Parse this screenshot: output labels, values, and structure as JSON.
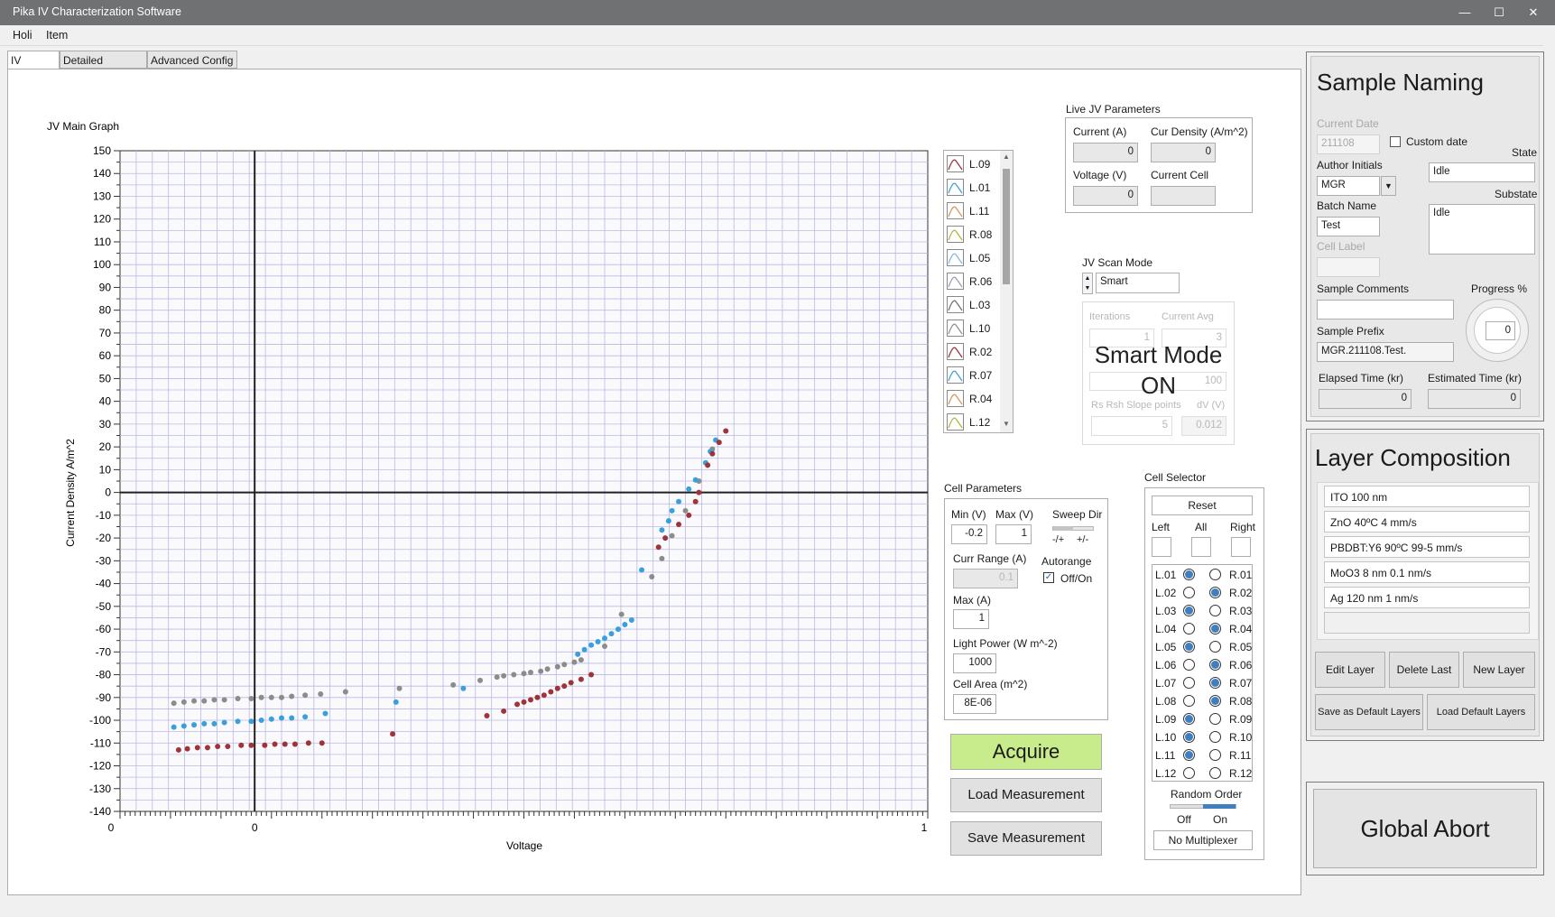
{
  "window": {
    "title": "Pika IV Characterization Software",
    "minimize": "—",
    "maximize": "☐",
    "close": "✕"
  },
  "menu": [
    "Holi",
    "Item"
  ],
  "tabs": [
    "IV Curves",
    "Detailed Analysis",
    "Advanced Config"
  ],
  "chart_data": {
    "type": "scatter",
    "title": "JV Main Graph",
    "xlabel": "Voltage",
    "ylabel": "Current Density A/m^2",
    "xlim": [
      -0.2,
      1
    ],
    "ylim": [
      -140,
      150
    ],
    "x_tick_labels": [
      "0",
      "0",
      "1"
    ],
    "y_ticks": [
      150,
      140,
      130,
      120,
      110,
      100,
      90,
      80,
      70,
      60,
      50,
      40,
      30,
      20,
      10,
      0,
      -10,
      -20,
      -30,
      -40,
      -50,
      -60,
      -70,
      -80,
      -90,
      -100,
      -110,
      -120,
      -130,
      -140
    ],
    "grid": true,
    "series": [
      {
        "color": "#8c8c8c",
        "points": [
          [
            -0.12,
            -92.5
          ],
          [
            -0.105,
            -92
          ],
          [
            -0.09,
            -91.5
          ],
          [
            -0.075,
            -91.5
          ],
          [
            -0.06,
            -91
          ],
          [
            -0.045,
            -91
          ],
          [
            -0.025,
            -90.5
          ],
          [
            -0.005,
            -90.5
          ],
          [
            0.01,
            -90
          ],
          [
            0.025,
            -90
          ],
          [
            0.04,
            -90
          ],
          [
            0.055,
            -89.5
          ],
          [
            0.075,
            -89
          ],
          [
            0.098,
            -88.5
          ],
          [
            0.135,
            -87.5
          ],
          [
            0.215,
            -86
          ],
          [
            0.295,
            -84.5
          ],
          [
            0.335,
            -82.5
          ],
          [
            0.36,
            -81
          ],
          [
            0.37,
            -80.5
          ],
          [
            0.385,
            -80
          ],
          [
            0.4,
            -79.5
          ],
          [
            0.41,
            -79
          ],
          [
            0.425,
            -78.5
          ],
          [
            0.435,
            -77.5
          ],
          [
            0.45,
            -76.5
          ],
          [
            0.46,
            -75.5
          ],
          [
            0.475,
            -74.5
          ],
          [
            0.485,
            -73.5
          ],
          [
            0.52,
            -67.5
          ],
          [
            0.545,
            -53.5
          ],
          [
            0.59,
            -37
          ],
          [
            0.605,
            -29
          ],
          [
            0.62,
            -19
          ],
          [
            0.64,
            -8
          ],
          [
            0.66,
            5
          ],
          [
            0.68,
            19
          ]
        ]
      },
      {
        "color": "#3aa0dd",
        "points": [
          [
            -0.12,
            -103
          ],
          [
            -0.105,
            -102.5
          ],
          [
            -0.09,
            -102
          ],
          [
            -0.075,
            -101.5
          ],
          [
            -0.06,
            -101.5
          ],
          [
            -0.045,
            -101
          ],
          [
            -0.025,
            -100.5
          ],
          [
            -0.005,
            -100.5
          ],
          [
            0.01,
            -100
          ],
          [
            0.025,
            -99.5
          ],
          [
            0.04,
            -99
          ],
          [
            0.055,
            -99
          ],
          [
            0.075,
            -98.5
          ],
          [
            0.105,
            -97
          ],
          [
            0.21,
            -92
          ],
          [
            0.31,
            -86
          ],
          [
            0.48,
            -71
          ],
          [
            0.49,
            -69
          ],
          [
            0.5,
            -67
          ],
          [
            0.51,
            -65.5
          ],
          [
            0.52,
            -64
          ],
          [
            0.53,
            -62
          ],
          [
            0.54,
            -60
          ],
          [
            0.55,
            -58
          ],
          [
            0.56,
            -56
          ],
          [
            0.575,
            -34
          ],
          [
            0.605,
            -16.5
          ],
          [
            0.615,
            -12.5
          ],
          [
            0.62,
            -8
          ],
          [
            0.63,
            -4
          ],
          [
            0.645,
            1.5
          ],
          [
            0.655,
            5.5
          ],
          [
            0.67,
            13
          ],
          [
            0.677,
            18
          ],
          [
            0.685,
            23
          ]
        ]
      },
      {
        "color": "#a0323a",
        "points": [
          [
            -0.113,
            -113
          ],
          [
            -0.1,
            -112.5
          ],
          [
            -0.085,
            -112
          ],
          [
            -0.07,
            -112
          ],
          [
            -0.055,
            -111.5
          ],
          [
            -0.04,
            -111.5
          ],
          [
            -0.02,
            -111
          ],
          [
            -0.005,
            -111
          ],
          [
            0.015,
            -111
          ],
          [
            0.03,
            -110.5
          ],
          [
            0.045,
            -110.5
          ],
          [
            0.06,
            -110.5
          ],
          [
            0.08,
            -110
          ],
          [
            0.1,
            -110
          ],
          [
            0.205,
            -106
          ],
          [
            0.345,
            -98
          ],
          [
            0.37,
            -96
          ],
          [
            0.39,
            -93
          ],
          [
            0.4,
            -92
          ],
          [
            0.41,
            -91
          ],
          [
            0.42,
            -90
          ],
          [
            0.43,
            -89
          ],
          [
            0.44,
            -87.5
          ],
          [
            0.45,
            -86
          ],
          [
            0.46,
            -85
          ],
          [
            0.47,
            -83.5
          ],
          [
            0.485,
            -82
          ],
          [
            0.5,
            -80
          ],
          [
            0.6,
            -24
          ],
          [
            0.61,
            -20
          ],
          [
            0.63,
            -14
          ],
          [
            0.645,
            -10
          ],
          [
            0.655,
            -4
          ],
          [
            0.66,
            0
          ],
          [
            0.673,
            12
          ],
          [
            0.68,
            17
          ],
          [
            0.69,
            22
          ],
          [
            0.7,
            27
          ]
        ]
      }
    ]
  },
  "legend": [
    {
      "label": "L.09",
      "color": "#a0323a"
    },
    {
      "label": "L.01",
      "color": "#3aa0dd"
    },
    {
      "label": "L.11",
      "color": "#d8955a"
    },
    {
      "label": "R.08",
      "color": "#b5b53a"
    },
    {
      "label": "L.05",
      "color": "#7fb8e8"
    },
    {
      "label": "R.06",
      "color": "#9aa0b8"
    },
    {
      "label": "L.03",
      "color": "#707070"
    },
    {
      "label": "L.10",
      "color": "#909090"
    },
    {
      "label": "R.02",
      "color": "#a0323a"
    },
    {
      "label": "R.07",
      "color": "#3aa0dd"
    },
    {
      "label": "R.04",
      "color": "#d8955a"
    },
    {
      "label": "L.12",
      "color": "#b5b53a"
    }
  ],
  "live": {
    "title": "Live JV Parameters",
    "current_label": "Current (A)",
    "current": "0",
    "curdens_label": "Cur Density (A/m^2)",
    "curdens": "0",
    "voltage_label": "Voltage (V)",
    "voltage": "0",
    "cell_label": "Current Cell",
    "cell": ""
  },
  "scan": {
    "title": "JV Scan Mode",
    "mode": "Smart",
    "iter_label": "Iterations",
    "iter": "1",
    "avg_label": "Current Avg",
    "avg": "3",
    "sweep_val": "100",
    "rs_label": "Rs Rsh Slope points",
    "rs": "5",
    "dv_label": "dV (V)",
    "dv": "0.012",
    "smart_overlay": "Smart Mode ON"
  },
  "cellparams": {
    "title": "Cell Parameters",
    "min_label": "Min (V)",
    "min": "-0.2",
    "max_label": "Max (V)",
    "max": "1",
    "sweep_label": "Sweep Dir",
    "sweep_minus": "-/+",
    "sweep_plus": "+/-",
    "curr_range_label": "Curr Range (A)",
    "curr_range": "0.1",
    "autorange_label": "Autorange",
    "autorange_toggle": "Off/On",
    "maxa_label": "Max (A)",
    "maxa": "1",
    "light_label": "Light Power (W m^-2)",
    "light": "1000",
    "area_label": "Cell Area (m^2)",
    "area": "8E-06"
  },
  "actions": {
    "acquire": "Acquire",
    "load": "Load Measurement",
    "save": "Save Measurement"
  },
  "selector": {
    "title": "Cell Selector",
    "reset": "Reset",
    "left": "Left",
    "all": "All",
    "right": "Right",
    "rows": [
      {
        "l": "L.01",
        "lon": true,
        "r": "R.01",
        "ron": false
      },
      {
        "l": "L.02",
        "lon": false,
        "r": "R.02",
        "ron": true
      },
      {
        "l": "L.03",
        "lon": true,
        "r": "R.03",
        "ron": false
      },
      {
        "l": "L.04",
        "lon": false,
        "r": "R.04",
        "ron": true
      },
      {
        "l": "L.05",
        "lon": true,
        "r": "R.05",
        "ron": false
      },
      {
        "l": "L.06",
        "lon": false,
        "r": "R.06",
        "ron": true
      },
      {
        "l": "L.07",
        "lon": false,
        "r": "R.07",
        "ron": true
      },
      {
        "l": "L.08",
        "lon": false,
        "r": "R.08",
        "ron": true
      },
      {
        "l": "L.09",
        "lon": true,
        "r": "R.09",
        "ron": false
      },
      {
        "l": "L.10",
        "lon": true,
        "r": "R.10",
        "ron": false
      },
      {
        "l": "L.11",
        "lon": true,
        "r": "R.11",
        "ron": false
      },
      {
        "l": "L.12",
        "lon": false,
        "r": "R.12",
        "ron": false
      }
    ],
    "random_label": "Random Order",
    "off": "Off",
    "on": "On",
    "mux": "No Multiplexer"
  },
  "naming": {
    "title": "Sample Naming",
    "date_label": "Current Date",
    "date": "211108",
    "custom_date": "Custom date",
    "state_label": "State",
    "state": "Idle",
    "author_label": "Author Initials",
    "author": "MGR",
    "substate_label": "Substate",
    "substate": "Idle",
    "batch_label": "Batch Name",
    "batch": "Test",
    "cell_label": "Cell Label",
    "cell": "",
    "comments_label": "Sample Comments",
    "comments": "",
    "progress_label": "Progress %",
    "progress": "0",
    "prefix_label": "Sample Prefix",
    "prefix": "MGR.211108.Test.",
    "elapsed_label": "Elapsed Time (kr)",
    "elapsed": "0",
    "estimated_label": "Estimated Time (kr)",
    "estimated": "0"
  },
  "layers": {
    "title": "Layer Composition",
    "items": [
      "ITO  100 nm",
      "ZnO  40ºC 4 mm/s",
      "PBDBT:Y6  90ºC 99-5 mm/s",
      "MoO3  8 nm 0.1 nm/s",
      "Ag  120 nm 1 nm/s",
      ""
    ],
    "edit": "Edit Layer",
    "delete": "Delete Last",
    "new": "New Layer",
    "save_default": "Save as Default Layers",
    "load_default": "Load Default Layers"
  },
  "abort": "Global Abort",
  "colors": {
    "acquire_bg": "#c8eb8c",
    "accent": "#3f7fc0"
  }
}
